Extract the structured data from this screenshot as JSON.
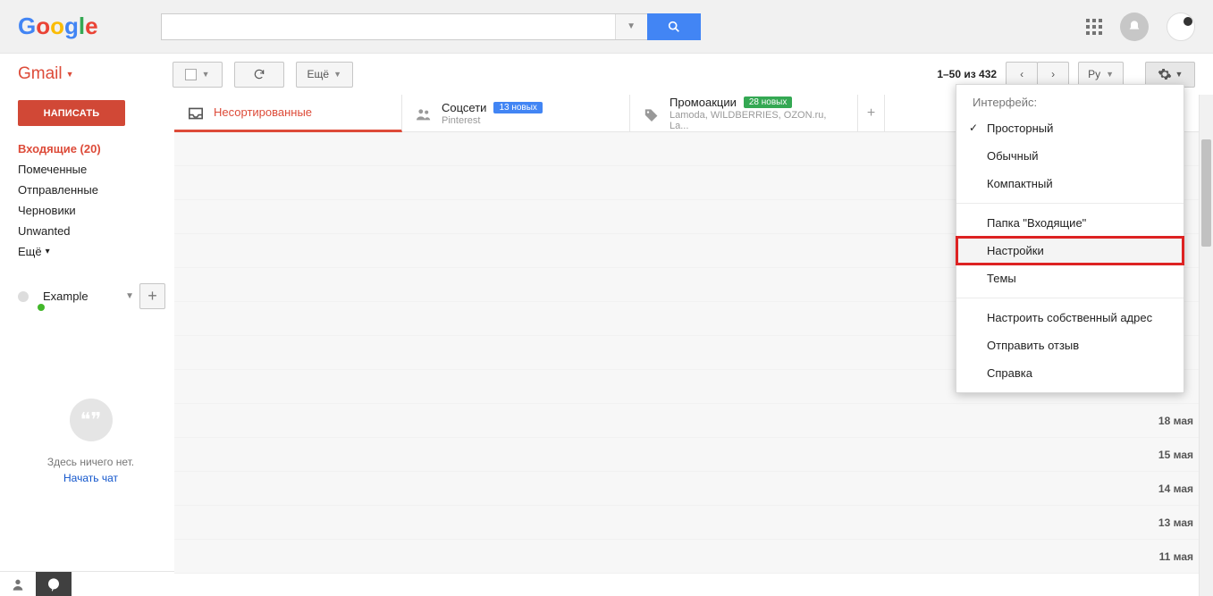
{
  "header": {
    "logo_text": "Google",
    "search_placeholder": ""
  },
  "brand": "Gmail",
  "toolbar": {
    "more_label": "Ещё",
    "paging": "1–50 из 432",
    "lang": "Ру"
  },
  "sidebar": {
    "compose": "НАПИСАТЬ",
    "items": [
      {
        "label": "Входящие (20)",
        "active": true
      },
      {
        "label": "Помеченные"
      },
      {
        "label": "Отправленные"
      },
      {
        "label": "Черновики"
      },
      {
        "label": "Unwanted"
      }
    ],
    "more": "Ещё"
  },
  "hangouts": {
    "name": "Example",
    "empty_text": "Здесь ничего нет.",
    "start_chat": "Начать чат"
  },
  "tabs": {
    "primary": "Несортированные",
    "social_title": "Соцсети",
    "social_badge": "13 новых",
    "social_sub": "Pinterest",
    "promo_title": "Промоакции",
    "promo_badge": "28 новых",
    "promo_sub": "Lamoda, WILDBERRIES, OZON.ru, La..."
  },
  "dates": [
    "18 мая",
    "15 мая",
    "14 мая",
    "13 мая",
    "11 мая"
  ],
  "menu": {
    "interface_label": "Интерфейс:",
    "density": [
      "Просторный",
      "Обычный",
      "Компактный"
    ],
    "inbox_folder": "Папка \"Входящие\"",
    "settings": "Настройки",
    "themes": "Темы",
    "custom_address": "Настроить собственный адрес",
    "feedback": "Отправить отзыв",
    "help": "Справка"
  }
}
